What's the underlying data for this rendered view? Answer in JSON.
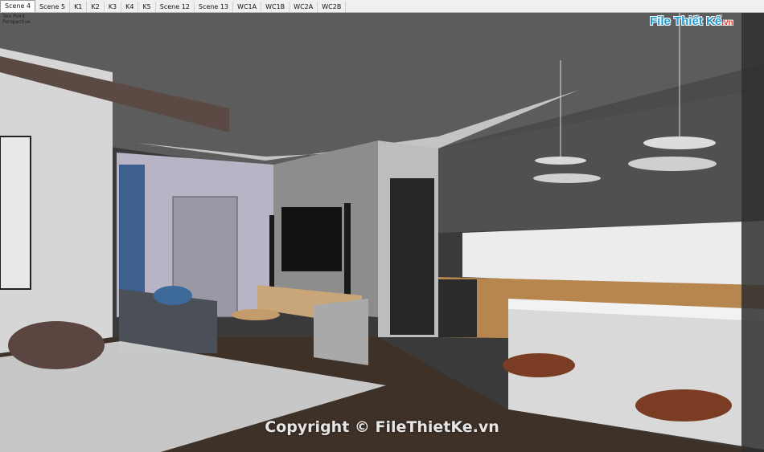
{
  "scene_tabs": [
    {
      "label": "Scene 4",
      "active": true
    },
    {
      "label": "Scene 5",
      "active": false
    },
    {
      "label": "K1",
      "active": false
    },
    {
      "label": "K2",
      "active": false
    },
    {
      "label": "K3",
      "active": false
    },
    {
      "label": "K4",
      "active": false
    },
    {
      "label": "K5",
      "active": false
    },
    {
      "label": "Scene 12",
      "active": false
    },
    {
      "label": "Scene 13",
      "active": false
    },
    {
      "label": "WC1A",
      "active": false
    },
    {
      "label": "WC1B",
      "active": false
    },
    {
      "label": "WC2A",
      "active": false
    },
    {
      "label": "WC2B",
      "active": false
    }
  ],
  "camera": {
    "line1": "Two Point",
    "line2": "Perspective"
  },
  "logo": {
    "main": "File Thiết Kế",
    "suffix": ".vn"
  },
  "watermark": "Copyright © FileThietKe.vn",
  "colors": {
    "logo_blue": "#1d9ad6",
    "logo_red": "#e23b2a",
    "ceiling": "#5a5a5a",
    "floor": "#3b3026",
    "cabinet": "#4d4e50",
    "backsplash": "#e9e9e9"
  }
}
